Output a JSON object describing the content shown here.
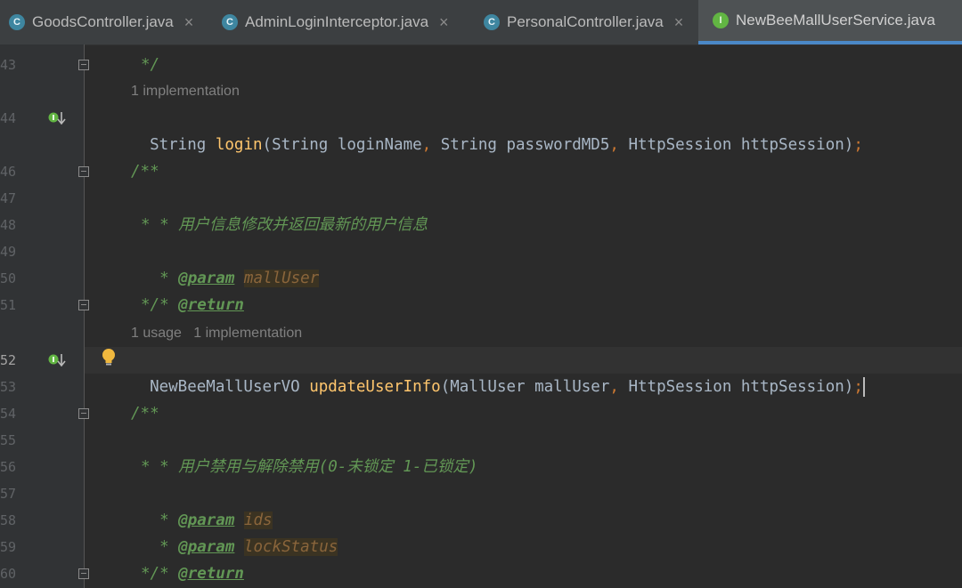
{
  "tabs": [
    {
      "label": "GoodsController.java",
      "icon": "class-icon",
      "active": false
    },
    {
      "label": "AdminLoginInterceptor.java",
      "icon": "class-icon",
      "active": false
    },
    {
      "label": "PersonalController.java",
      "icon": "class-icon",
      "active": false
    },
    {
      "label": "NewBeeMallUserService.java",
      "icon": "interface-icon",
      "active": true
    }
  ],
  "tab_icon_letters": {
    "class": "C",
    "interface": "I"
  },
  "close_glyph": "×",
  "line_numbers": [
    "43",
    "44",
    "46",
    "47",
    "48",
    "49",
    "50",
    "51",
    "52",
    "53",
    "54",
    "55",
    "56",
    "57",
    "58",
    "59",
    "60"
  ],
  "hints": {
    "login": "1 implementation",
    "update": "1 usage   1 implementation"
  },
  "code": {
    "l43_end": "*/",
    "login_type": "String ",
    "login_name": "login",
    "login_open": "(",
    "login_p1": "String loginName",
    "login_c1": ", ",
    "login_p2": "String passwordMD5",
    "login_c2": ", ",
    "login_p3": "HttpSession httpSession",
    "login_close": ")",
    "login_semi": ";",
    "doc_open": "/**",
    "doc1_star": "* ",
    "doc1_text": "用户信息修改并返回最新的用户信息",
    "star": "*",
    "tag_param": "@param",
    "tag_return": "@return",
    "doc1_param": "mallUser",
    "doc_close": "*/",
    "update_type": "NewBeeMallUserVO ",
    "update_name": "updateUserInfo",
    "update_open": "(",
    "update_p1": "MallUser mallUser",
    "update_c1": ", ",
    "update_p2": "HttpSession httpSession",
    "update_close": ")",
    "update_semi": ";",
    "doc2_text": "用户禁用与解除禁用(0-未锁定 1-已锁定)",
    "doc2_param1": "ids",
    "doc2_param2": "lockStatus"
  },
  "colors": {
    "background": "#2b2b2b",
    "doc_comment": "#629755",
    "method": "#ffc66d",
    "punctuation": "#cc7832",
    "text": "#a9b7c6",
    "active_tab_underline": "#4a88c7"
  }
}
